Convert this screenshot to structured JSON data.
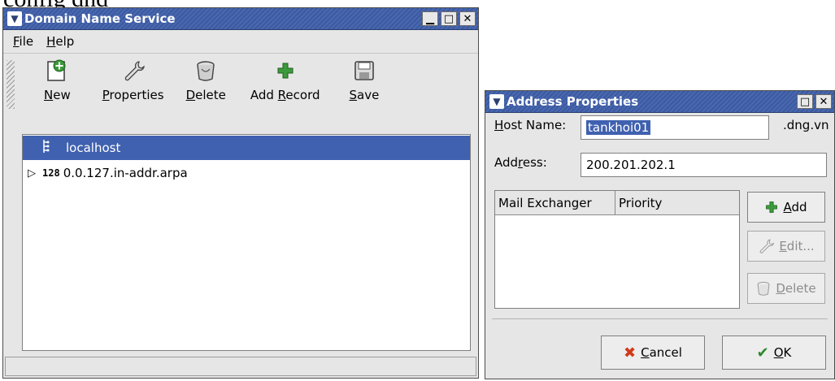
{
  "background_text": "config dnd",
  "main_window": {
    "title": "Domain Name Service",
    "controls": [
      "minimize-icon",
      "maximize-icon",
      "close-icon"
    ],
    "menu": [
      {
        "accel": "F",
        "rest": "ile"
      },
      {
        "accel": "H",
        "rest": "elp"
      }
    ],
    "toolbar": {
      "new": {
        "accel": "N",
        "rest": "ew",
        "icon": "new-document-icon"
      },
      "properties": {
        "accel": "P",
        "rest": "roperties",
        "icon": "wrench-icon"
      },
      "delete": {
        "accel": "D",
        "rest": "elete",
        "icon": "trash-icon"
      },
      "add_record": {
        "pre": "Add ",
        "accel": "R",
        "rest": "ecord",
        "icon": "plus-icon"
      },
      "save": {
        "accel": "S",
        "rest": "ave",
        "icon": "floppy-icon"
      }
    },
    "tree": [
      {
        "label": "localhost",
        "selected": true,
        "icon": "zone-icon"
      },
      {
        "label": "0.0.127.in-addr.arpa",
        "selected": false,
        "icon": "reverse-zone-icon",
        "expander": "▷"
      }
    ]
  },
  "dialog": {
    "title": "Address Properties",
    "host_label": {
      "accel": "H",
      "rest": "ost Name:"
    },
    "host_value": "tankhoi01",
    "host_suffix": ".dng.vn",
    "address_label": {
      "pre": "Add",
      "accel": "r",
      "rest": "ess:"
    },
    "address_value": "200.201.202.1",
    "columns": [
      "Mail Exchanger",
      "Priority"
    ],
    "buttons": {
      "add": {
        "accel": "A",
        "rest": "dd",
        "enabled": true
      },
      "edit": {
        "accel": "E",
        "rest": "dit...",
        "enabled": false
      },
      "delete": {
        "accel": "D",
        "rest": "elete",
        "enabled": false
      },
      "cancel": {
        "accel": "C",
        "rest": "ancel"
      },
      "ok": {
        "accel": "O",
        "rest": "K"
      }
    }
  },
  "colors": {
    "titlebar": "#3b5aa0",
    "selection": "#4061b0",
    "window_bg": "#e6e6e6"
  }
}
